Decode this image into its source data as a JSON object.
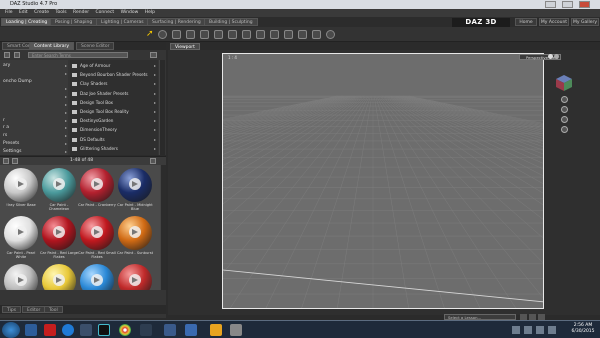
{
  "window": {
    "title": "DAZ Studio 4.7 Pro"
  },
  "menu": [
    "File",
    "Edit",
    "Create",
    "Tools",
    "Render",
    "Connect",
    "Window",
    "Help"
  ],
  "top_tabs": [
    {
      "label": "Loading | Creating",
      "active": true
    },
    {
      "label": "Posing | Shaping",
      "active": false
    },
    {
      "label": "Lighting | Cameras",
      "active": false
    },
    {
      "label": "Surfacing | Rendering",
      "active": false
    },
    {
      "label": "Building | Sculpting",
      "active": false
    }
  ],
  "brand": "DAZ 3D",
  "header_buttons": [
    "Home",
    "My Account",
    "My Gallery"
  ],
  "panel_tabs": [
    "Smart Content",
    "Content Library",
    "Scene Editor"
  ],
  "search_placeholder": "Enter Search Terms",
  "categories": [
    {
      "label": "ary",
      "has_children": true
    },
    {
      "label": "",
      "has_children": true
    },
    {
      "label": "oncho Dump",
      "has_children": false
    },
    {
      "label": "",
      "has_children": true
    },
    {
      "label": "",
      "has_children": true
    },
    {
      "label": "",
      "has_children": true
    },
    {
      "label": "",
      "has_children": true
    },
    {
      "label": "r",
      "has_children": true
    },
    {
      "label": "r a",
      "has_children": true
    },
    {
      "label": "rs",
      "has_children": true
    },
    {
      "label": "Presets",
      "has_children": true
    },
    {
      "label": "Settings",
      "has_children": true
    }
  ],
  "subfolders": [
    "Age of Armour",
    "Beyond Bourbon Shader Presets",
    "Clay Shaders",
    "Daz Joe Shader Presets",
    "Design Tool Box",
    "Design Tool Box Reality",
    "DestinysGarden",
    "DimensionTheory",
    "DS Defaults",
    "Glittering Shaders"
  ],
  "page_info": "1-48 of 48",
  "thumbnails": [
    {
      "label": "!Iray Silver Base",
      "color": "#c9c9c9",
      "highlight": "#ffffff"
    },
    {
      "label": "Car Paint - Chameleon",
      "color": "#4a9a9c",
      "highlight": "#c9e4e2"
    },
    {
      "label": "Car Paint - Cranberry",
      "color": "#b3202e",
      "highlight": "#f0a0a8"
    },
    {
      "label": "Car Paint - Midnight Blue",
      "color": "#1a2c66",
      "highlight": "#8aa0d8"
    },
    {
      "label": "Car Paint - Pearl White",
      "color": "#e0e0e0",
      "highlight": "#ffffff"
    },
    {
      "label": "Car Paint - Red Large Flakes",
      "color": "#b0141e",
      "highlight": "#f58e96"
    },
    {
      "label": "Car Paint - Red Small Flakes",
      "color": "#c0181e",
      "highlight": "#f7a0a4"
    },
    {
      "label": "Car Paint - Sunburst",
      "color": "#d06a14",
      "highlight": "#ffd090"
    },
    {
      "label": "",
      "color": "#bdbdbd",
      "highlight": "#f4f4f4"
    },
    {
      "label": "",
      "color": "#e8c838",
      "highlight": "#fff6b0"
    },
    {
      "label": "",
      "color": "#2a88d6",
      "highlight": "#a9d8ff"
    },
    {
      "label": "",
      "color": "#c02a2a",
      "highlight": "#f59a9a"
    }
  ],
  "bottom_tabs": [
    "Tips",
    "Editor",
    "Tool"
  ],
  "viewport": {
    "tab": "Viewport",
    "label": "1 : 4",
    "perspective": "Perspective View"
  },
  "lesson_placeholder": "Select a Lesson...",
  "taskbar": {
    "time": "2:56 AM",
    "date": "6/30/2015"
  },
  "colors": {
    "viewport_bg": "#6d6d6d",
    "grid_line": "#7d7d7d",
    "accent": "#e8c838"
  }
}
